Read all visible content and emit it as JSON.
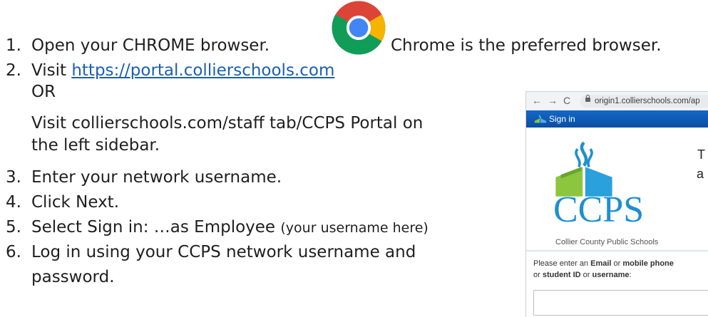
{
  "steps": [
    {
      "num": "1.",
      "text": "Open your CHROME browser."
    },
    {
      "num": "2.",
      "text_prefix": "Visit ",
      "link": "https://portal.collierschools.com"
    },
    {
      "num": "3.",
      "text": "Enter your network username."
    },
    {
      "num": "4.",
      "text": "Click Next."
    },
    {
      "num": "5.",
      "text": "Select Sign in:  …as Employee",
      "note": "(your username here)"
    },
    {
      "num": "6.",
      "text": "Log in using your CCPS network username and",
      "text_line2": "password."
    }
  ],
  "chrome_note": "Chrome is the preferred browser.",
  "step2_or": "OR",
  "step2_alt_line1": "Visit collierschools.com/staff tab/CCPS Portal on",
  "step2_alt_line2": "the left sidebar.",
  "icons": {
    "browser_logo": "chrome-logo-icon"
  },
  "thumbnail": {
    "nav_back": "←",
    "nav_forward": "→",
    "nav_reload": "C",
    "url": "origin1.collierschools.com/ap",
    "signin_label": "Sign in",
    "logo_text": "CCPS",
    "logo_subtitle": "Collier County Public Schools",
    "side_text_1": "T",
    "side_text_2": "a",
    "prompt_prefix": "Please enter an ",
    "prompt_email": "Email",
    "prompt_or1": " or ",
    "prompt_mobile": "mobile phone",
    "prompt_or2": " or ",
    "prompt_student": "student ID",
    "prompt_or3": " or ",
    "prompt_username": "username",
    "prompt_suffix": ":",
    "input_value": ""
  },
  "colors": {
    "link": "#1a5fb4",
    "signbar": "#1467c7",
    "ccps_blue": "#1e8fd0",
    "ccps_green": "#8cc63f"
  }
}
